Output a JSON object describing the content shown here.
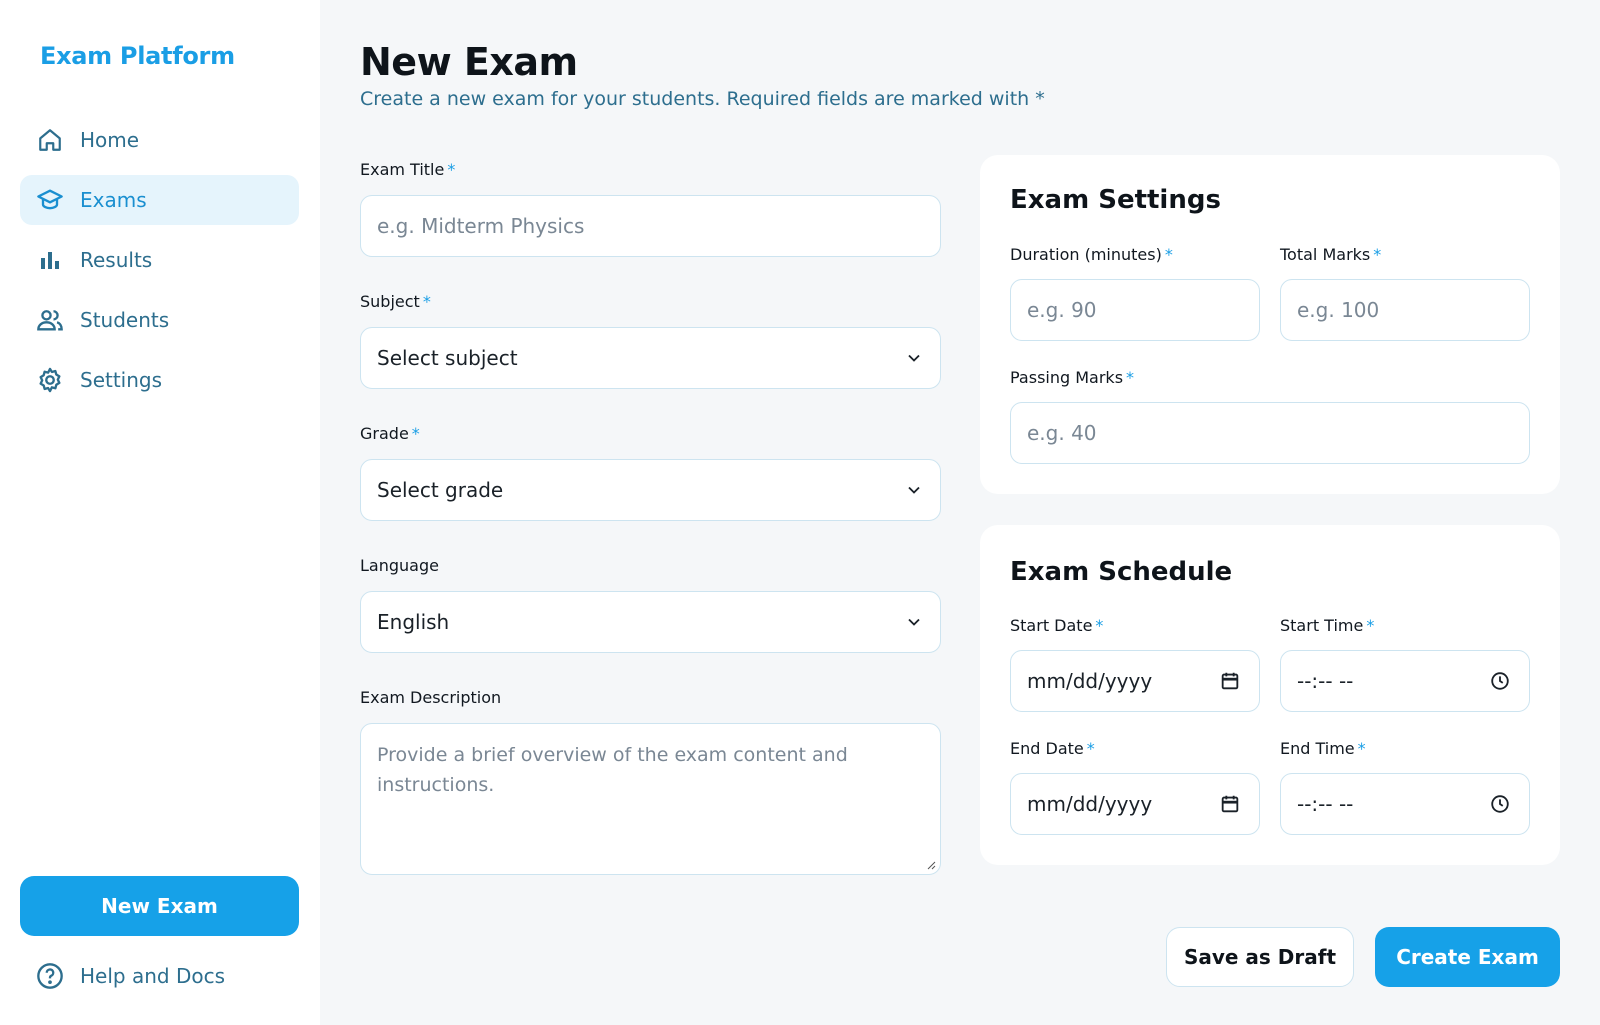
{
  "brand": "Exam Platform",
  "nav": [
    {
      "label": "Home",
      "icon": "home-icon"
    },
    {
      "label": "Exams",
      "icon": "graduation-cap-icon",
      "active": true
    },
    {
      "label": "Results",
      "icon": "bar-chart-icon"
    },
    {
      "label": "Students",
      "icon": "users-icon"
    },
    {
      "label": "Settings",
      "icon": "gear-icon"
    }
  ],
  "sidebar_button": "New Exam",
  "help": "Help and Docs",
  "page": {
    "title": "New Exam",
    "subtitle": "Create a new exam for your students. Required fields are marked with *"
  },
  "form": {
    "exam_title": {
      "label": "Exam Title",
      "required": "*",
      "placeholder": "e.g. Midterm Physics"
    },
    "subject": {
      "label": "Subject",
      "required": "*",
      "value": "Select subject"
    },
    "grade": {
      "label": "Grade",
      "required": "*",
      "value": "Select grade"
    },
    "language": {
      "label": "Language",
      "value": "English"
    },
    "description": {
      "label": "Exam Description",
      "placeholder": "Provide a brief overview of the exam content and instructions."
    }
  },
  "settings": {
    "title": "Exam Settings",
    "duration": {
      "label": "Duration (minutes)",
      "required": "*",
      "placeholder": "e.g. 90"
    },
    "total_marks": {
      "label": "Total Marks",
      "required": "*",
      "placeholder": "e.g. 100"
    },
    "passing_marks": {
      "label": "Passing Marks",
      "required": "*",
      "placeholder": "e.g. 40"
    }
  },
  "schedule": {
    "title": "Exam Schedule",
    "start_date": {
      "label": "Start Date",
      "required": "*",
      "value": "mm/dd/yyyy"
    },
    "start_time": {
      "label": "Start Time",
      "required": "*",
      "value": "--:-- --"
    },
    "end_date": {
      "label": "End Date",
      "required": "*",
      "value": "mm/dd/yyyy"
    },
    "end_time": {
      "label": "End Time",
      "required": "*",
      "value": "--:-- --"
    }
  },
  "actions": {
    "draft": "Save as Draft",
    "create": "Create Exam"
  },
  "colors": {
    "accent": "#16a1e8",
    "nav_text": "#2d6e8e",
    "active_bg": "#e5f4fc"
  }
}
